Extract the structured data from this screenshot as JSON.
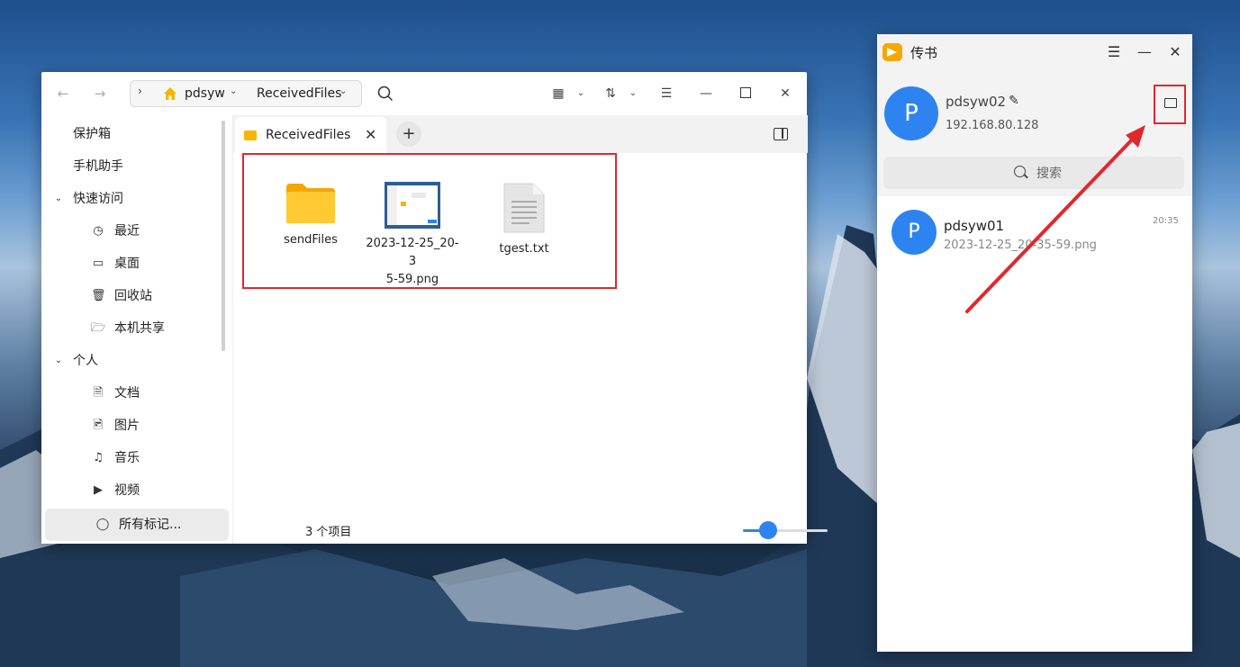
{
  "file_manager": {
    "breadcrumb": [
      "pdsyw",
      "ReceivedFiles"
    ],
    "sidebar": [
      {
        "label": "保护箱"
      },
      {
        "label": "手机助手"
      },
      {
        "label": "快速访问"
      },
      {
        "label": "最近"
      },
      {
        "label": "桌面"
      },
      {
        "label": "回收站"
      },
      {
        "label": "本机共享"
      },
      {
        "label": "个人"
      },
      {
        "label": "文档"
      },
      {
        "label": "图片"
      },
      {
        "label": "音乐"
      },
      {
        "label": "视频"
      },
      {
        "label": "所有标记..."
      }
    ],
    "tab_label": "ReceivedFiles",
    "files": [
      {
        "name": "sendFiles",
        "icon": "folder-icon"
      },
      {
        "name_line1": "2023-12-25_20-3",
        "name_line2": "5-59.png",
        "icon": "image-thumbnail"
      },
      {
        "name": "tgest.txt",
        "icon": "text-file-icon"
      }
    ],
    "status": "3 个项目",
    "zoom_fraction": 0.28,
    "colors": {
      "accent": "#2d84f0",
      "highlight": "#e0282e"
    }
  },
  "chuanshu": {
    "title": "传书",
    "avatar_letter": "P",
    "device_name": "pdsyw02",
    "ip": "192.168.80.128",
    "search_placeholder": "搜索",
    "contacts": [
      {
        "avatar": "P",
        "name": "pdsyw01",
        "last_message": "2023-12-25_20-35-59.png",
        "time": "20:35"
      }
    ]
  }
}
